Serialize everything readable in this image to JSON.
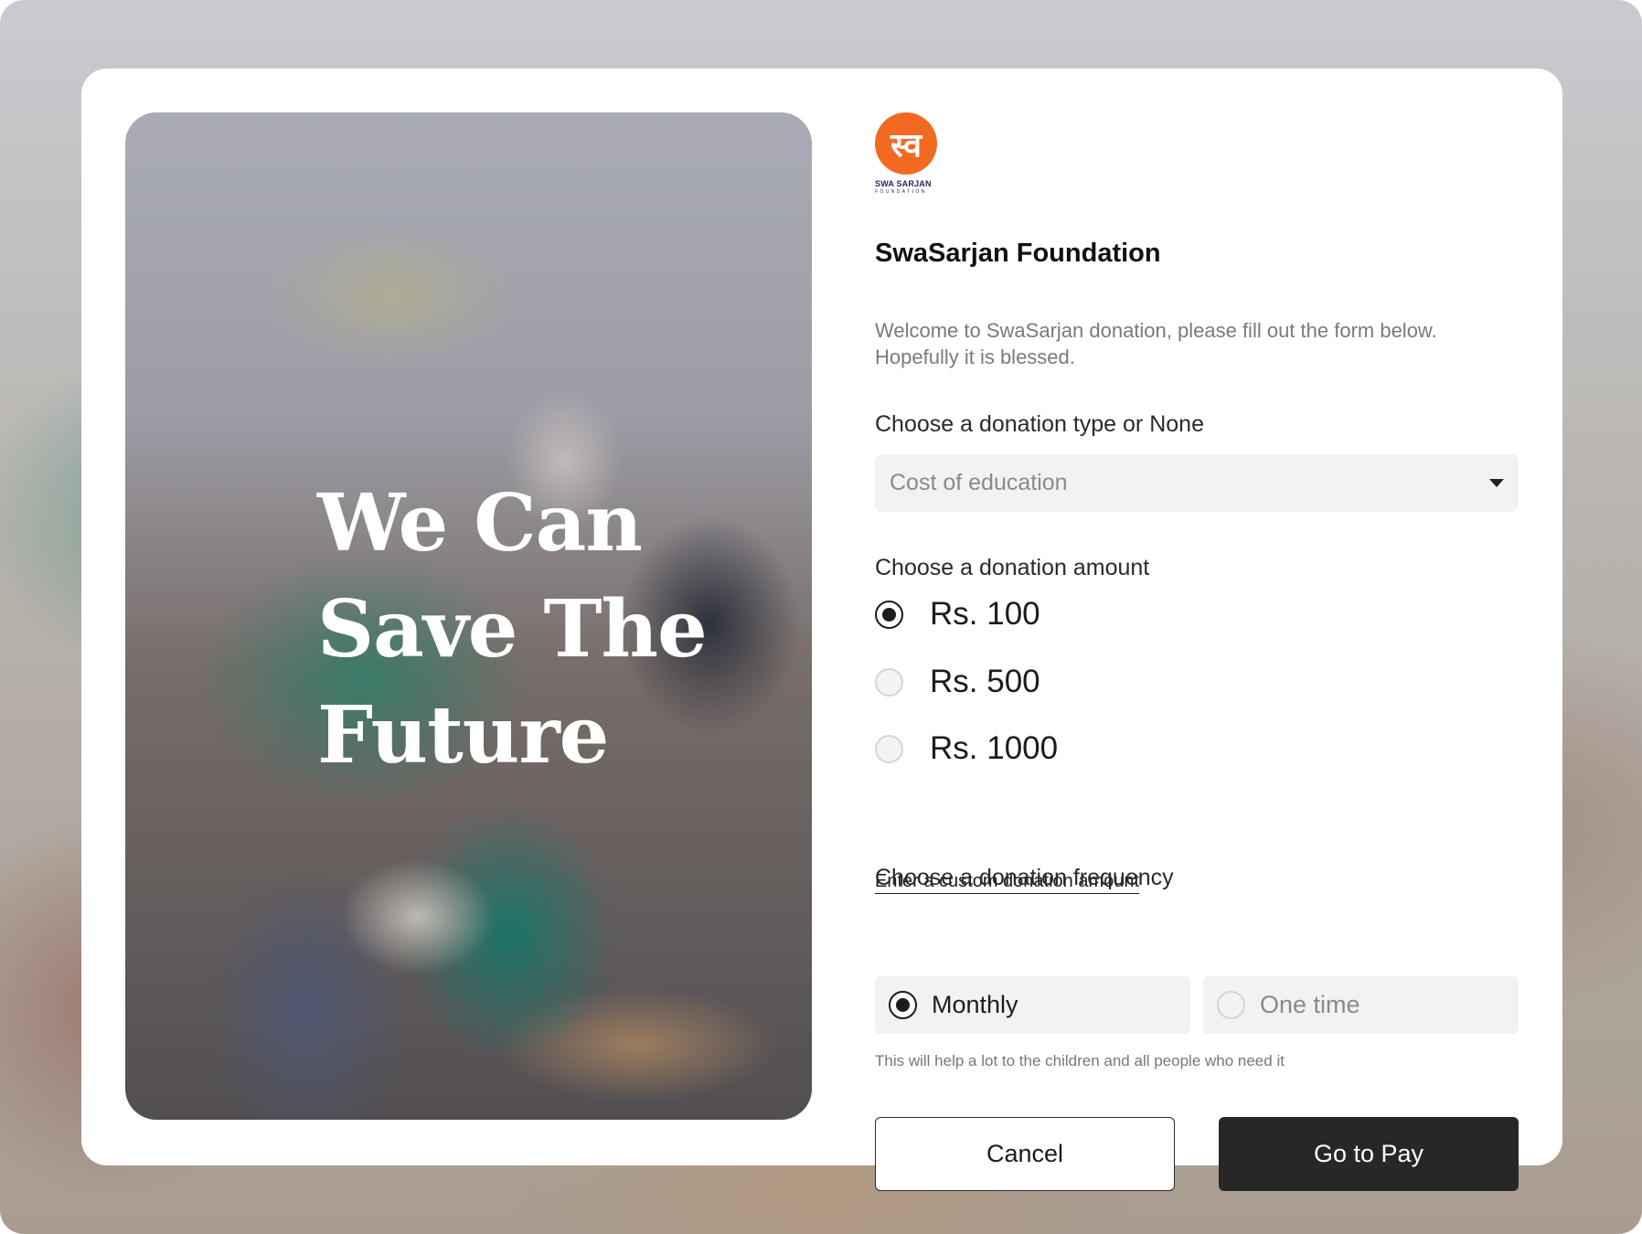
{
  "hero": {
    "title": "We Can\nSave The\nFuture"
  },
  "brand": {
    "logo_glyph": "स्व",
    "logo_name": "SWA SARJAN",
    "logo_sub": "FOUNDATION",
    "org_name": "SwaSarjan Foundation",
    "accent_color": "#f26a21"
  },
  "form": {
    "welcome": "Welcome to SwaSarjan donation, please fill out the form below. Hopefully it is blessed.",
    "type_label": "Choose a donation type or None",
    "type_value": "Cost of education",
    "amount_label": "Choose a donation amount",
    "amounts": [
      {
        "label": "Rs. 100",
        "selected": true
      },
      {
        "label": "Rs. 500",
        "selected": false
      },
      {
        "label": "Rs. 1000",
        "selected": false
      }
    ],
    "custom_link": "Enter a custom donation amount",
    "frequency_label": "Choose a donation frequency",
    "frequencies": [
      {
        "label": "Monthly",
        "selected": true
      },
      {
        "label": "One time",
        "selected": false
      }
    ],
    "hint": "This will help a lot to the children and all people who need it",
    "cancel_label": "Cancel",
    "pay_label": "Go to Pay"
  }
}
